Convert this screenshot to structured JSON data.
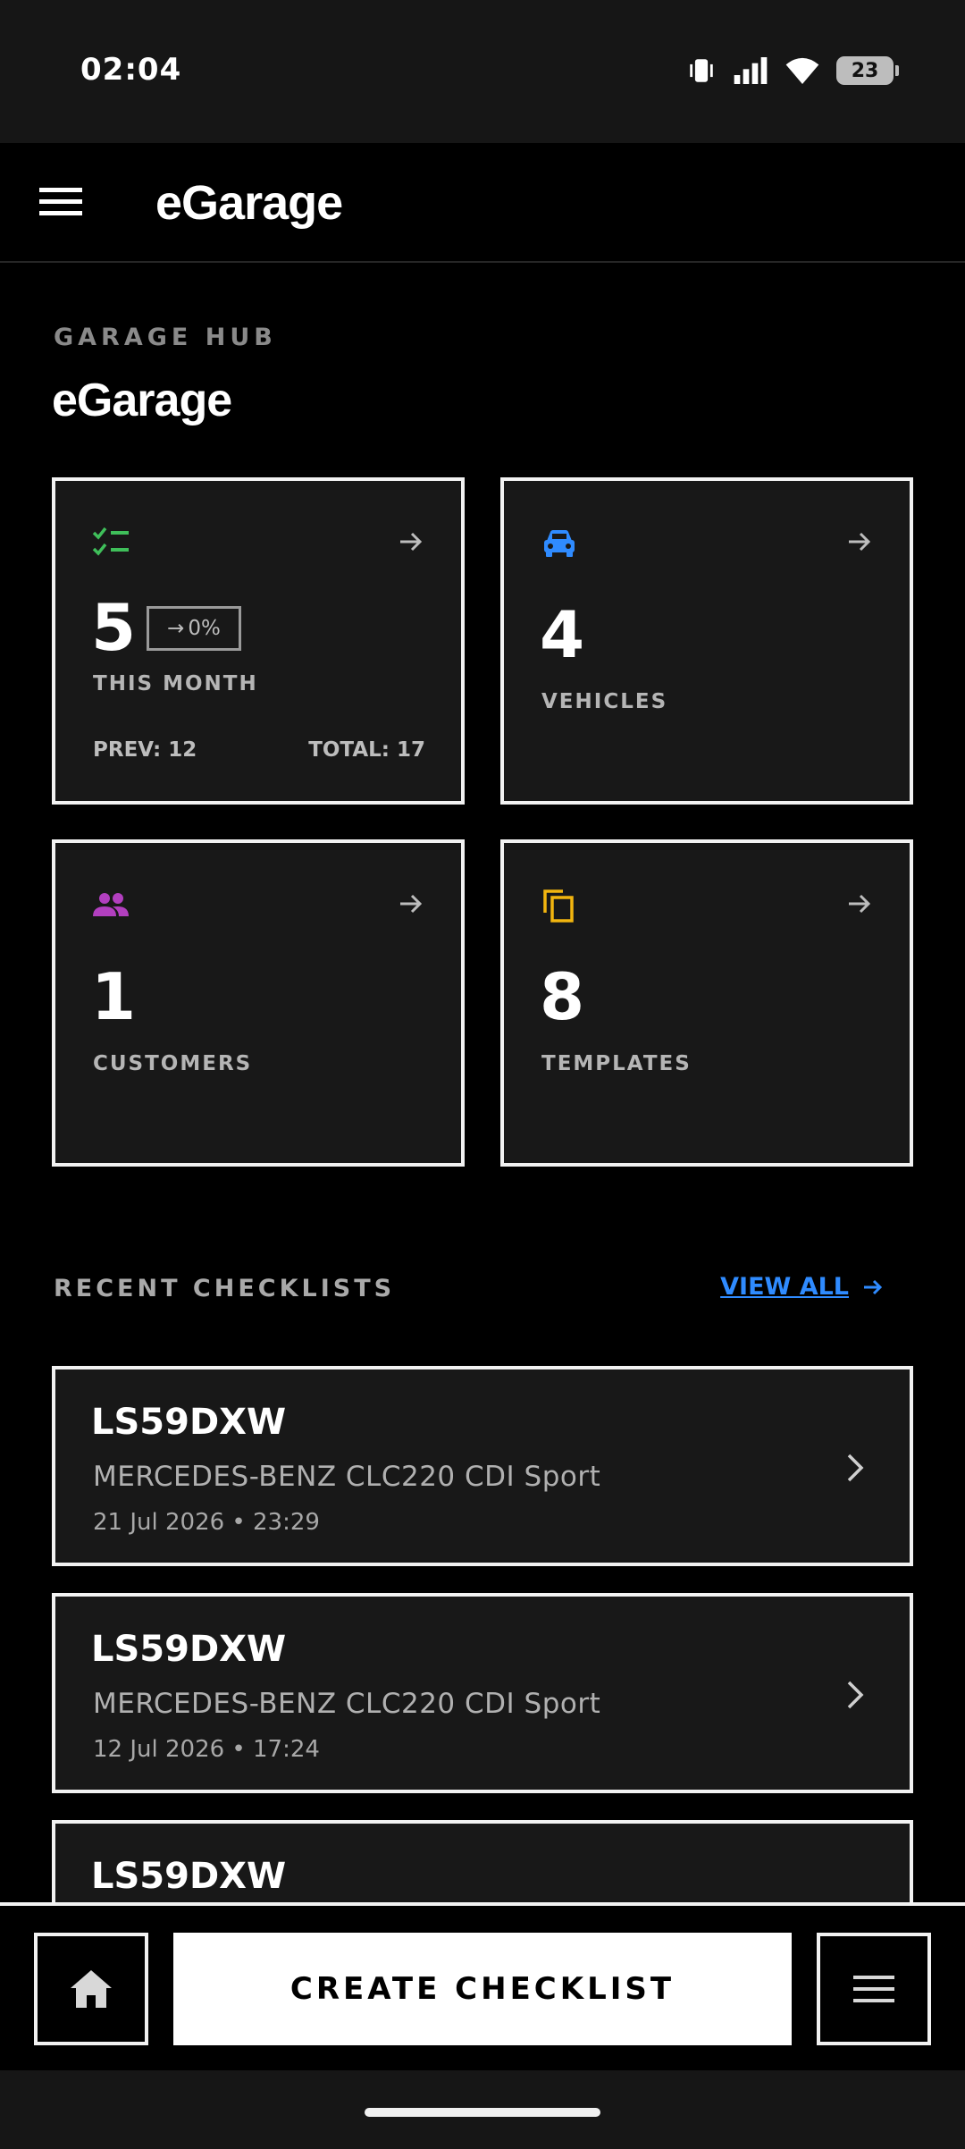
{
  "status_bar": {
    "time": "02:04",
    "battery": "23"
  },
  "app_bar": {
    "title": "eGarage"
  },
  "hub": {
    "eyebrow": "GARAGE HUB",
    "title": "eGarage"
  },
  "stats": {
    "checklists": {
      "value": "5",
      "trend": "0%",
      "label": "THIS MONTH",
      "prev": "PREV: 12",
      "total": "TOTAL: 17",
      "icon": "checklist-icon",
      "icon_color": "#3fbf5a"
    },
    "vehicles": {
      "value": "4",
      "label": "VEHICLES",
      "icon": "car-icon",
      "icon_color": "#2f8bff"
    },
    "customers": {
      "value": "1",
      "label": "CUSTOMERS",
      "icon": "people-icon",
      "icon_color": "#b23fbf"
    },
    "templates": {
      "value": "8",
      "label": "TEMPLATES",
      "icon": "copy-icon",
      "icon_color": "#f2b50f"
    }
  },
  "recent": {
    "title": "RECENT CHECKLISTS",
    "view_all": "VIEW ALL",
    "items": [
      {
        "plate": "LS59DXW",
        "vehicle": "MERCEDES-BENZ CLC220 CDI Sport",
        "date": "21 Jul 2026 • 23:29"
      },
      {
        "plate": "LS59DXW",
        "vehicle": "MERCEDES-BENZ CLC220 CDI Sport",
        "date": "12 Jul 2026 • 17:24"
      },
      {
        "plate": "LS59DXW"
      }
    ]
  },
  "bottom_bar": {
    "create_label": "CREATE CHECKLIST"
  }
}
